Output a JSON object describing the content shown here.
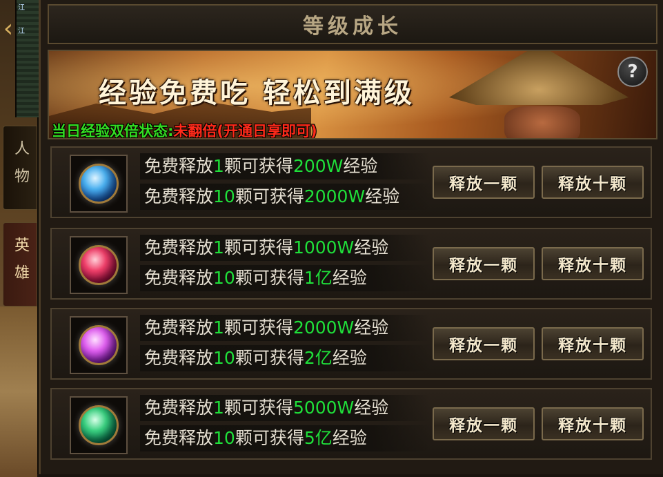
{
  "sidebar": {
    "tabs": [
      {
        "label": "人物",
        "active": false
      },
      {
        "label": "英雄",
        "active": true
      }
    ],
    "minimap_text": [
      "江",
      "江"
    ]
  },
  "header": {
    "title": "等级成长"
  },
  "banner": {
    "slogan": "经验免费吃 轻松到满级",
    "status_label": "当日经验双倍状态:",
    "status_value": "未翻倍(开通日享即可)",
    "help_icon": "?"
  },
  "colors": {
    "highlight": "#1fe03a",
    "status_value": "#ff2a1a",
    "status_label": "#33dd22"
  },
  "items": [
    {
      "orb_color": "blue",
      "line1": {
        "prefix": "免费释放",
        "count": "1",
        "mid": "颗可获得",
        "amount": "200W",
        "suffix": "经验"
      },
      "line2": {
        "prefix": "免费释放",
        "count": "10",
        "mid": "颗可获得",
        "amount": "2000W",
        "suffix": "经验"
      },
      "btn_one": "释放一颗",
      "btn_ten": "释放十颗"
    },
    {
      "orb_color": "red",
      "line1": {
        "prefix": "免费释放",
        "count": "1",
        "mid": "颗可获得",
        "amount": "1000W",
        "suffix": "经验"
      },
      "line2": {
        "prefix": "免费释放",
        "count": "10",
        "mid": "颗可获得",
        "amount": "1亿",
        "suffix": "经验"
      },
      "btn_one": "释放一颗",
      "btn_ten": "释放十颗"
    },
    {
      "orb_color": "purple",
      "line1": {
        "prefix": "免费释放",
        "count": "1",
        "mid": "颗可获得",
        "amount": "2000W",
        "suffix": "经验"
      },
      "line2": {
        "prefix": "免费释放",
        "count": "10",
        "mid": "颗可获得",
        "amount": "2亿",
        "suffix": "经验"
      },
      "btn_one": "释放一颗",
      "btn_ten": "释放十颗"
    },
    {
      "orb_color": "green",
      "line1": {
        "prefix": "免费释放",
        "count": "1",
        "mid": "颗可获得",
        "amount": "5000W",
        "suffix": "经验"
      },
      "line2": {
        "prefix": "免费释放",
        "count": "10",
        "mid": "颗可获得",
        "amount": "5亿",
        "suffix": "经验"
      },
      "btn_one": "释放一颗",
      "btn_ten": "释放十颗"
    }
  ]
}
